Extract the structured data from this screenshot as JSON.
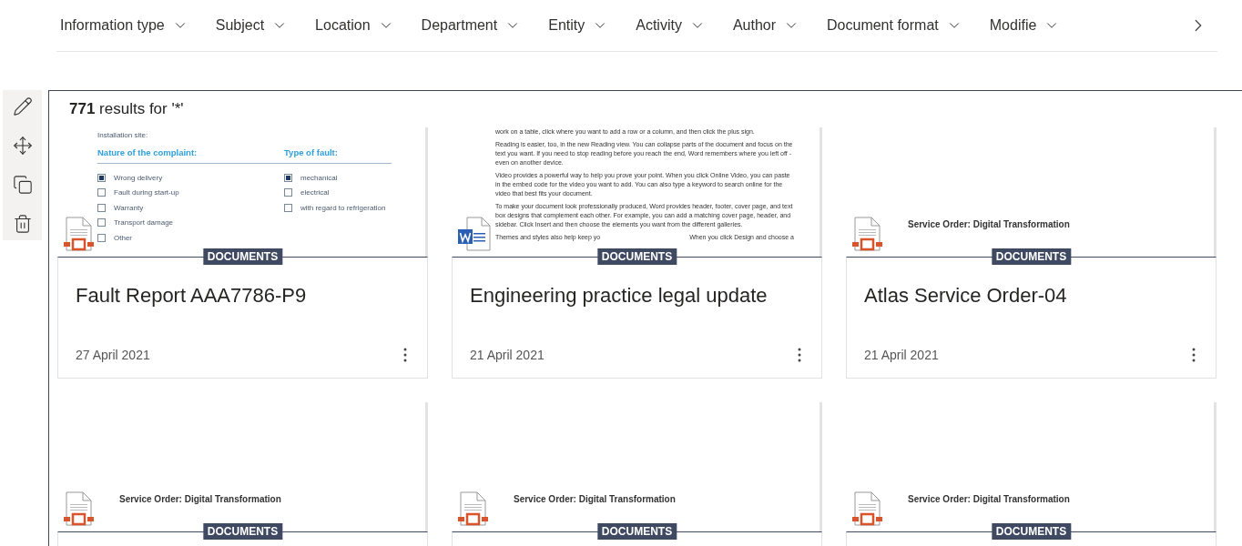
{
  "filters": [
    {
      "label": "Information type"
    },
    {
      "label": "Subject"
    },
    {
      "label": "Location"
    },
    {
      "label": "Department"
    },
    {
      "label": "Entity"
    },
    {
      "label": "Activity"
    },
    {
      "label": "Author"
    },
    {
      "label": "Document format"
    },
    {
      "label": "Modifie"
    }
  ],
  "toolbar": [
    {
      "kind": "edit"
    },
    {
      "kind": "move"
    },
    {
      "kind": "copy"
    },
    {
      "kind": "delete"
    }
  ],
  "results": {
    "heading": "**771** results for '*'"
  },
  "cards": [
    {
      "badge": "DOCUMENTS",
      "file_icon": {
        "kind": "generic"
      },
      "title": "Fault Report AAA7786-P9",
      "date": "27 April 2021",
      "preview": {
        "kind": "form",
        "lines": [
          "Installation site:"
        ],
        "columns": [
          {
            "heading": "Nature of the complaint:",
            "options": [
              {
                "label": "Wrong delivery",
                "checked": true
              },
              {
                "label": "Fault during start-up",
                "checked": false
              },
              {
                "label": "Warranty",
                "checked": false
              },
              {
                "label": "Transport damage",
                "checked": false
              },
              {
                "label": "Other",
                "checked": false
              }
            ]
          },
          {
            "heading": "Type of fault:",
            "options": [
              {
                "label": "mechanical",
                "checked": true
              },
              {
                "label": "electrical",
                "checked": false
              },
              {
                "label": "with regard to refrigeration",
                "checked": false
              }
            ]
          }
        ]
      }
    },
    {
      "badge": "DOCUMENTS",
      "file_icon": {
        "kind": "word"
      },
      "title": "Engineering practice legal update",
      "date": "21 April 2021",
      "preview": {
        "kind": "text",
        "paragraphs": [
          "work on a table, click where you want to add a row or a column, and then click the plus sign.",
          "Reading is easier, too, in the new Reading view. You can collapse parts of the document and focus on the text you want. If you need to stop reading before you reach the end, Word remembers where you left off - even on another device.",
          "Video provides a powerful way to help you prove your point. When you click Online Video, you can paste in the embed code for the video you want to add. You can also type a keyword to search online for the video that best fits your document.",
          "To make your document look professionally produced, Word provides header, footer, cover page, and text box designs that complement each other. For example, you can add a matching cover page, header, and sidebar. Click Insert and then choose the elements you want from the different galleries."
        ],
        "last_line": [
          "Themes and styles also help keep yo",
          "When you click Design and choose a"
        ]
      }
    },
    {
      "badge": "DOCUMENTS",
      "file_icon": {
        "kind": "generic"
      },
      "title": "Atlas Service Order-04",
      "date": "21 April 2021",
      "preview": {
        "kind": "title",
        "text": "Service Order: Digital Transformation"
      }
    },
    {
      "badge": "DOCUMENTS",
      "file_icon": {
        "kind": "generic"
      },
      "preview": {
        "kind": "title",
        "text": "Service Order: Digital Transformation"
      }
    },
    {
      "badge": "DOCUMENTS",
      "file_icon": {
        "kind": "generic"
      },
      "preview": {
        "kind": "title",
        "text": "Service Order: Digital Transformation"
      }
    },
    {
      "badge": "DOCUMENTS",
      "file_icon": {
        "kind": "generic"
      },
      "preview": {
        "kind": "title",
        "text": "Service Order: Digital Transformation"
      }
    }
  ]
}
